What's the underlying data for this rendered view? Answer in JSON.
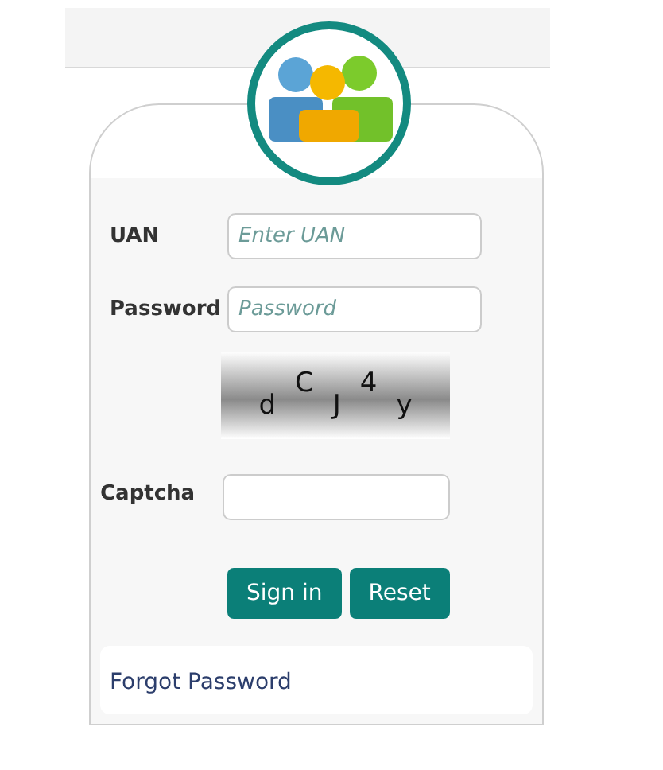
{
  "form": {
    "fields": [
      {
        "label": "UAN",
        "placeholder": "Enter UAN"
      },
      {
        "label": "Password",
        "placeholder": "Password"
      }
    ],
    "captcha_image": {
      "text": "dCJ4y"
    },
    "captcha_field": {
      "label": "Captcha"
    },
    "buttons": [
      "Sign in",
      "Reset"
    ],
    "forgot_link": "Forgot Password"
  }
}
